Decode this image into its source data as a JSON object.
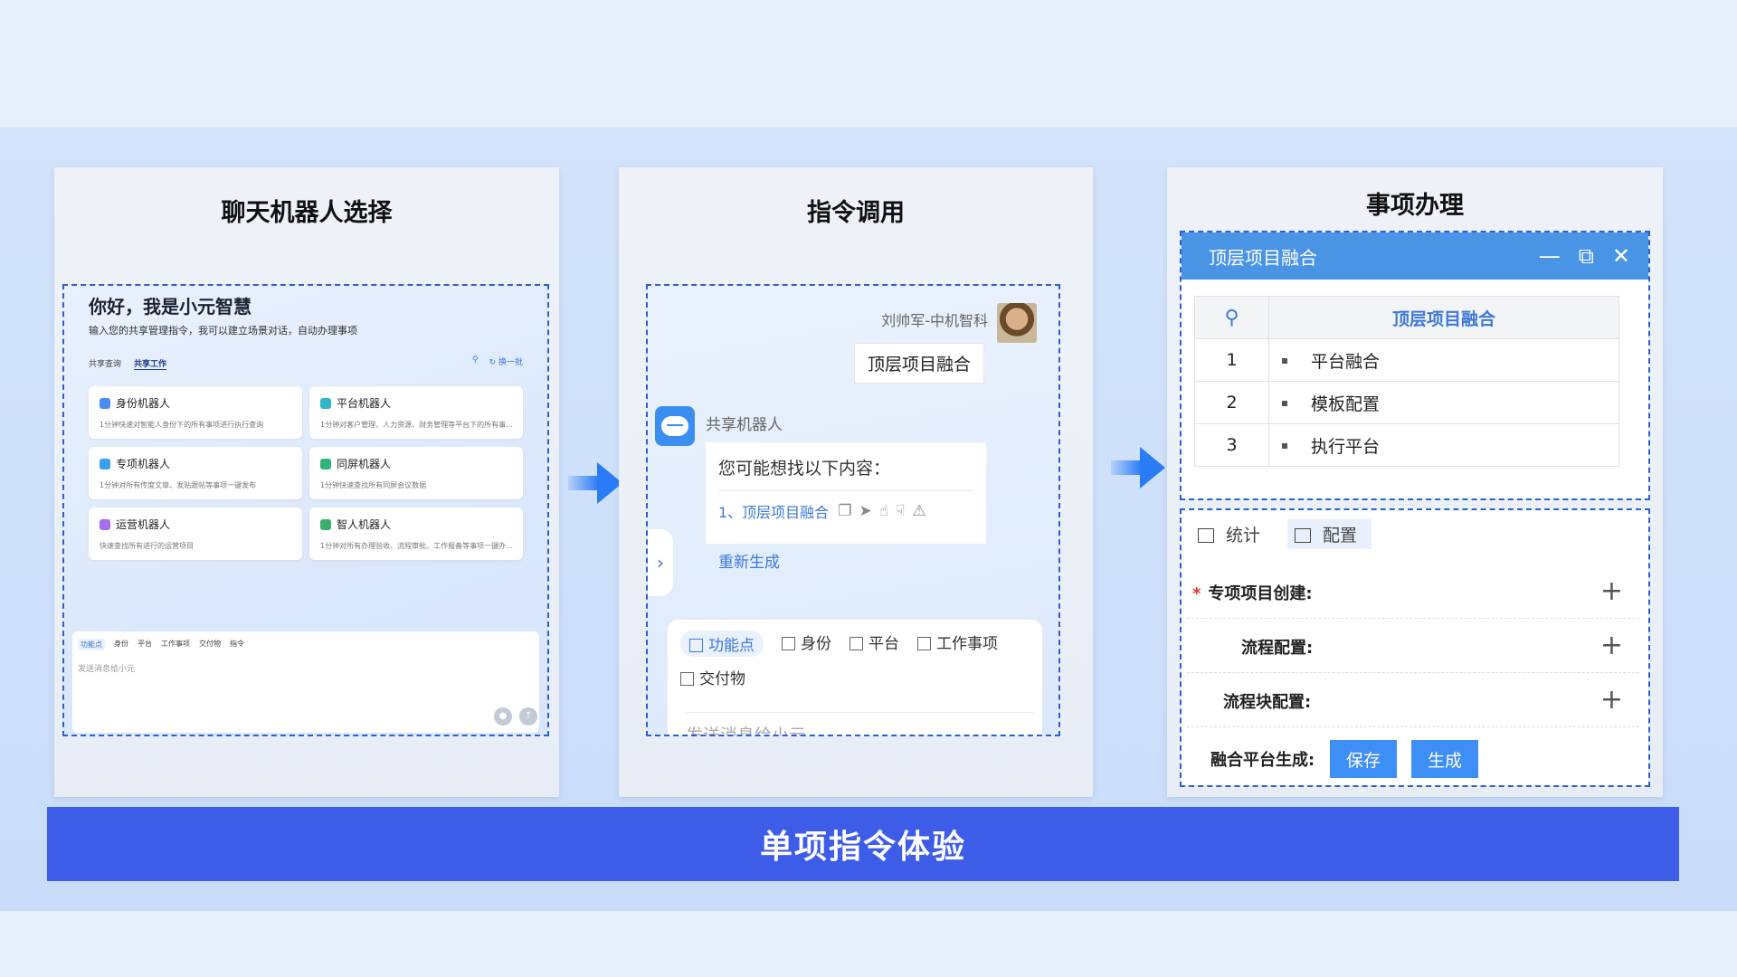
{
  "banner": "单项指令体验",
  "panels": {
    "chatbot_select": {
      "title": "聊天机器人选择",
      "greeting": "你好，我是小元智慧",
      "subtitle": "输入您的共享管理指令，我可以建立场景对话，自动办理事项",
      "tabs": [
        "共享查询",
        "共享工作"
      ],
      "tools": [
        "换一批"
      ],
      "bots": [
        {
          "name": "身份机器人",
          "desc": "1分钟快速对智能人身份下的所有事项进行执行查询",
          "color": "#4a8cf0",
          "icon": "person-icon"
        },
        {
          "name": "平台机器人",
          "desc": "1分钟对客户管理、人力资源、财务管理等平台下的所有事...",
          "color": "#2fb7c9",
          "icon": "layers-icon"
        },
        {
          "name": "专项机器人",
          "desc": "1分钟对所有传度文章、发贴跟帖等事项一键发布",
          "color": "#3aa0e8",
          "icon": "briefcase-icon"
        },
        {
          "name": "同屏机器人",
          "desc": "1分钟快速查找所有同屏会议数据",
          "color": "#32b37a",
          "icon": "screen-icon"
        },
        {
          "name": "运营机器人",
          "desc": "快速查找所有进行的运营项目",
          "color": "#a66cf0",
          "icon": "chart-icon"
        },
        {
          "name": "智人机器人",
          "desc": "1分钟对所有办理验收、流程审批、工作报备等事项一键办...",
          "color": "#3ab06a",
          "icon": "doc-icon"
        }
      ],
      "chips": [
        "功能点",
        "身份",
        "平台",
        "工作事项",
        "交付物",
        "指令"
      ],
      "placeholder": "发送消息给小元"
    },
    "command_call": {
      "title": "指令调用",
      "user": "刘帅军-中机智科",
      "user_msg": "顶层项目融合",
      "bot_name": "共享机器人",
      "question": "您可能想找以下内容：",
      "answer": "1、顶层项目融合",
      "regenerate": "重新生成",
      "chips": [
        "功能点",
        "身份",
        "平台",
        "工作事项",
        "交付物"
      ],
      "placeholder": "发送消息给小元"
    },
    "item_handle": {
      "title": "事项办理",
      "window_title": "顶层项目融合",
      "table_header": "顶层项目融合",
      "rows": [
        {
          "num": "1",
          "label": "平台融合"
        },
        {
          "num": "2",
          "label": "模板配置"
        },
        {
          "num": "3",
          "label": "执行平台"
        }
      ],
      "tabs": [
        "统计",
        "配置"
      ],
      "form": {
        "special": "专项项目创建:",
        "flow": "流程配置:",
        "flow_block": "流程块配置:",
        "merge": "融合平台生成:"
      },
      "save": "保存",
      "generate": "生成"
    }
  }
}
